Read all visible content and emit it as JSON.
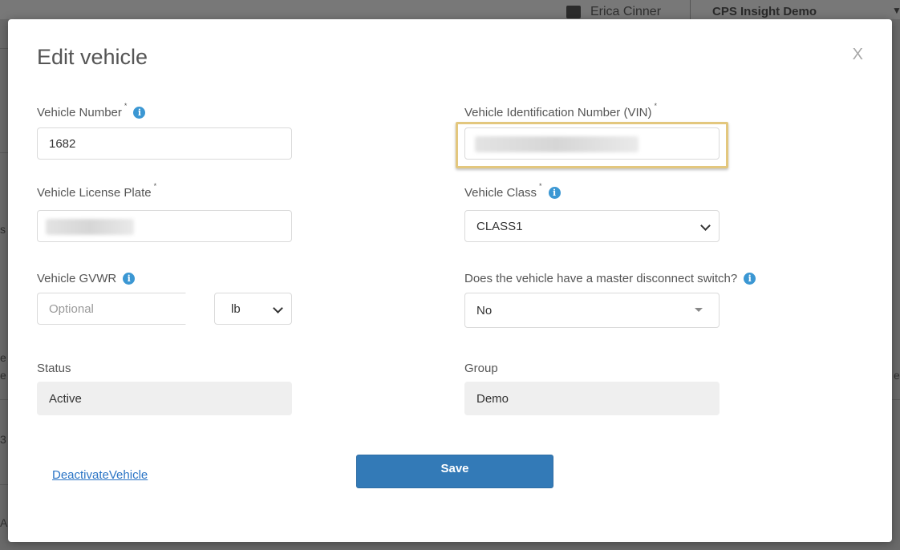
{
  "background": {
    "user_name": "Erica Cinner",
    "org_name": "CPS Insight Demo",
    "fragments": [
      "s",
      "e",
      "e",
      "e",
      "3",
      "A"
    ]
  },
  "modal": {
    "title": "Edit vehicle",
    "close_label": "X"
  },
  "form": {
    "vehicle_number": {
      "label": "Vehicle Number",
      "required": "*",
      "value": "1682"
    },
    "vin": {
      "label": "Vehicle Identification Number (VIN)",
      "required": "*",
      "value": ""
    },
    "license_plate": {
      "label": "Vehicle License Plate",
      "required": "*",
      "value": ""
    },
    "vehicle_class": {
      "label": "Vehicle Class",
      "required": "*",
      "value": "CLASS1"
    },
    "gvwr": {
      "label": "Vehicle GVWR",
      "placeholder": "Optional",
      "unit": "lb"
    },
    "master_switch": {
      "label": "Does the vehicle have a master disconnect switch?",
      "value": "No"
    },
    "status": {
      "label": "Status",
      "value": "Active"
    },
    "group": {
      "label": "Group",
      "value": "Demo"
    }
  },
  "actions": {
    "deactivate_label": "DeactivateVehicle",
    "save_label": "Save"
  },
  "icons": {
    "info": "info-icon",
    "close": "close-icon",
    "chevron": "chevron-down-icon",
    "caret": "caret-down-icon"
  },
  "colors": {
    "accent": "#337ab7",
    "info": "#3b97d3",
    "highlight": "#e3c77e",
    "link": "#2a74c5"
  }
}
